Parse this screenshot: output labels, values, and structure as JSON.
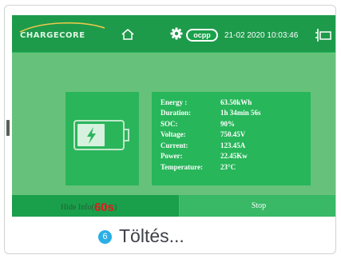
{
  "header": {
    "logo_text": "CHARGECORE",
    "ocpp_label": "ocpp",
    "datetime": "21-02 2020  10:03:46"
  },
  "charging_info": [
    {
      "label": "Energy :",
      "value": "63.50kWh"
    },
    {
      "label": "Duration:",
      "value": "1h 34min 56s"
    },
    {
      "label": "SOC:",
      "value": "90%"
    },
    {
      "label": "Voltage:",
      "value": "750.45V"
    },
    {
      "label": "Current:",
      "value": "123.45A"
    },
    {
      "label": "Power:",
      "value": "22.45Kw"
    },
    {
      "label": "Temperature:",
      "value": "23°C"
    }
  ],
  "buttons": {
    "hide_info_label": "Hide Info(",
    "hide_info_timer": "60s",
    "hide_info_close": ")",
    "stop_label": "Stop"
  },
  "caption": {
    "step": "6",
    "text": "Töltés..."
  },
  "icons": {
    "home": "home-icon",
    "settings": "gear-icon",
    "connector": "plug-icon",
    "battery": "battery-charging-icon"
  },
  "colors": {
    "screen_green": "#17a14b",
    "panel_green": "#66c27a",
    "timer_red": "#e01a1a",
    "step_blue": "#29aee6"
  }
}
